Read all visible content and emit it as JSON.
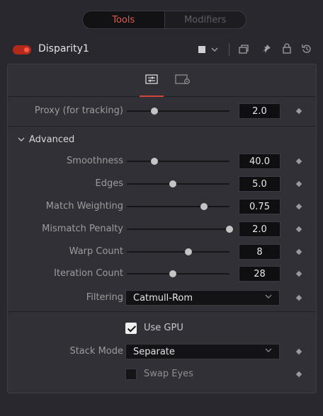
{
  "tabs": {
    "tools": "Tools",
    "modifiers": "Modifiers"
  },
  "node": {
    "name": "Disparity1"
  },
  "header_icons": [
    "color-swatch-icon",
    "chevron-down-icon",
    "versions-icon",
    "pin-icon",
    "lock-icon",
    "reset-icon"
  ],
  "proxy": {
    "label": "Proxy (for tracking)",
    "value": "2.0",
    "level": 0.27
  },
  "advanced": {
    "title": "Advanced",
    "smoothness": {
      "label": "Smoothness",
      "value": "40.0",
      "level": 0.27
    },
    "edges": {
      "label": "Edges",
      "value": "5.0",
      "level": 0.45
    },
    "match_weighting": {
      "label": "Match Weighting",
      "value": "0.75",
      "level": 0.75
    },
    "mismatch_penalty": {
      "label": "Mismatch Penalty",
      "value": "2.0",
      "level": 1.0
    },
    "warp_count": {
      "label": "Warp Count",
      "value": "8",
      "level": 0.6
    },
    "iteration_count": {
      "label": "Iteration Count",
      "value": "28",
      "level": 0.45
    },
    "filtering": {
      "label": "Filtering",
      "value": "Catmull-Rom"
    }
  },
  "use_gpu": {
    "label": "Use GPU",
    "checked": true
  },
  "stack_mode": {
    "label": "Stack Mode",
    "value": "Separate"
  },
  "swap_eyes": {
    "label": "Swap Eyes",
    "checked": false
  },
  "colors": {
    "accent": "#e05a4a",
    "toggle_on": "#b22a1c"
  }
}
